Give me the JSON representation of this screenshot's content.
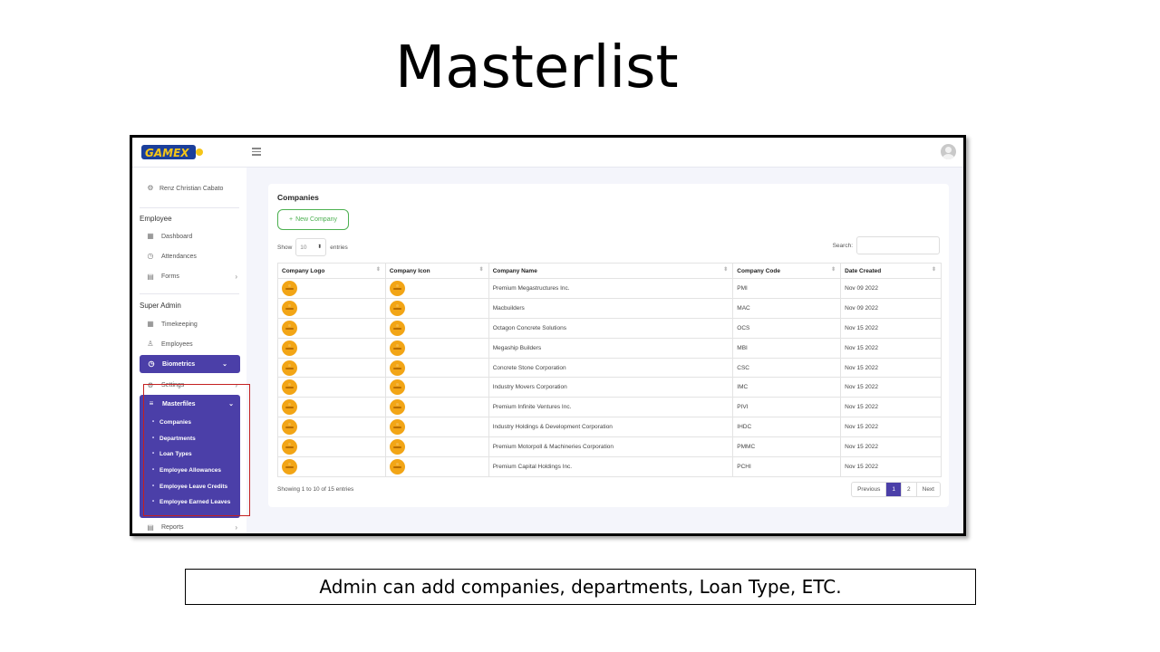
{
  "slide": {
    "title": "Masterlist",
    "caption": "Admin can add companies, departments, Loan Type, ETC."
  },
  "app": {
    "logo_text": "GAMEX",
    "accent_color": "#4b3fa8",
    "badge_color": "#f2a516"
  },
  "sidebar": {
    "user_name": "Renz Christian Cabato",
    "sections": [
      {
        "heading": "Employee",
        "items": [
          {
            "label": "Dashboard",
            "icon": "grid-icon"
          },
          {
            "label": "Attendances",
            "icon": "watch-icon"
          },
          {
            "label": "Forms",
            "icon": "form-icon",
            "chevron": "›"
          }
        ]
      },
      {
        "heading": "Super Admin",
        "items": [
          {
            "label": "Timekeeping",
            "icon": "grid-icon"
          },
          {
            "label": "Employees",
            "icon": "users-icon"
          },
          {
            "label": "Biometrics",
            "icon": "clock-icon",
            "chevron": "⌄",
            "active": true
          },
          {
            "label": "Settings",
            "icon": "gear-icon",
            "chevron": "›"
          }
        ]
      }
    ],
    "masterfiles": {
      "label": "Masterfiles",
      "chevron": "⌄",
      "subitems": [
        "Companies",
        "Departments",
        "Loan Types",
        "Employee Allowances",
        "Employee Leave Credits",
        "Employee Earned Leaves"
      ]
    },
    "reports": {
      "label": "Reports",
      "chevron": "›"
    }
  },
  "main": {
    "card_title": "Companies",
    "new_button": "New Company",
    "new_button_icon": "+",
    "show_label": "Show",
    "entries_value": "10",
    "entries_label": "entries",
    "search_label": "Search:",
    "columns": [
      "Company Logo",
      "Company Icon",
      "Company Name",
      "Company Code",
      "Date Created"
    ],
    "rows": [
      {
        "name": "Premium Megastructures Inc.",
        "code": "PMI",
        "date": "Nov 09 2022"
      },
      {
        "name": "Macbuilders",
        "code": "MAC",
        "date": "Nov 09 2022"
      },
      {
        "name": "Octagon Concrete Solutions",
        "code": "OCS",
        "date": "Nov 15 2022"
      },
      {
        "name": "Megaship Builders",
        "code": "MBI",
        "date": "Nov 15 2022"
      },
      {
        "name": "Concrete Stone Corporation",
        "code": "CSC",
        "date": "Nov 15 2022"
      },
      {
        "name": "Industry Movers Corporation",
        "code": "IMC",
        "date": "Nov 15 2022"
      },
      {
        "name": "Premium Infinite Ventures Inc.",
        "code": "PIVI",
        "date": "Nov 15 2022"
      },
      {
        "name": "Industry Holdings & Development Corporation",
        "code": "IHDC",
        "date": "Nov 15 2022"
      },
      {
        "name": "Premium Motorpoll & Machineries Corporation",
        "code": "PMMC",
        "date": "Nov 15 2022"
      },
      {
        "name": "Premium Capital Holdings Inc.",
        "code": "PCHI",
        "date": "Nov 15 2022"
      }
    ],
    "footer_info": "Showing 1 to 10 of 15 entries",
    "pager": {
      "previous": "Previous",
      "pages": [
        "1",
        "2"
      ],
      "next": "Next"
    }
  }
}
